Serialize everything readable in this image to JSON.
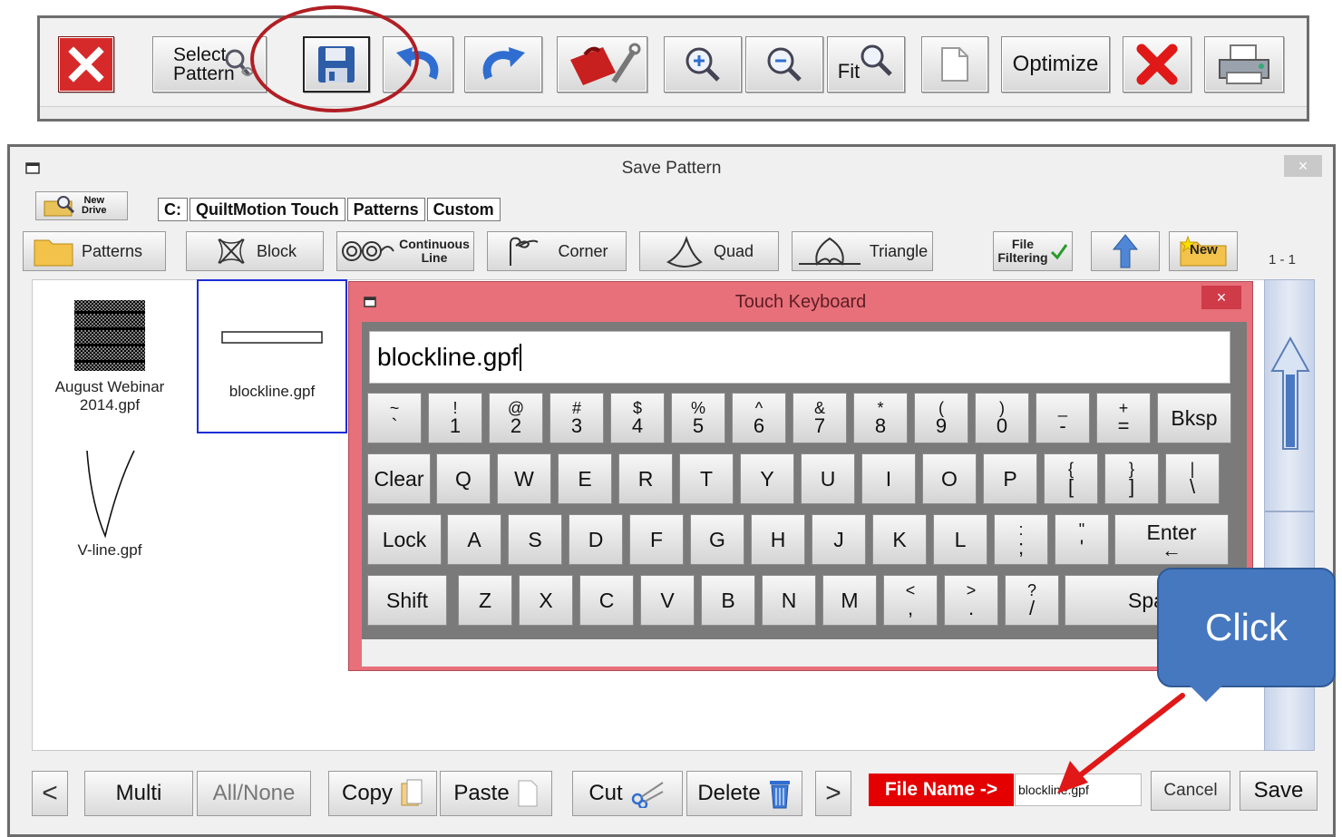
{
  "toolbar": {
    "select_pattern_line1": "Select",
    "select_pattern_line2": "Pattern",
    "fit_label": "Fit",
    "optimize_label": "Optimize"
  },
  "dialog": {
    "title": "Save Pattern",
    "close_glyph": "×",
    "new_drive_line1": "New",
    "new_drive_line2": "Drive",
    "breadcrumbs": [
      "C:",
      "QuiltMotion Touch",
      "Patterns",
      "Custom"
    ],
    "categories": {
      "patterns": "Patterns",
      "block": "Block",
      "continuous_line1": "Continuous",
      "continuous_line2": "Line",
      "corner": "Corner",
      "quad": "Quad",
      "triangle": "Triangle",
      "file_filtering_line1": "File",
      "file_filtering_line2": "Filtering",
      "new": "New"
    },
    "page_count": "1 - 1",
    "files": [
      {
        "name_line1": "August Webinar",
        "name_line2": "2014.gpf"
      },
      {
        "name_line1": "blockline.gpf",
        "name_line2": ""
      },
      {
        "name_line1": "V-line.gpf",
        "name_line2": ""
      }
    ],
    "bottom": {
      "prev": "<",
      "multi": "Multi",
      "all_none": "All/None",
      "copy": "Copy",
      "paste": "Paste",
      "cut": "Cut",
      "delete": "Delete",
      "next": ">",
      "file_name_label": "File Name ->",
      "file_name_value": "blockline.gpf",
      "cancel": "Cancel",
      "save": "Save"
    }
  },
  "keyboard": {
    "title": "Touch Keyboard",
    "close_glyph": "×",
    "input_value": "blockline.gpf",
    "row1": [
      {
        "top": "~",
        "bot": "`"
      },
      {
        "top": "!",
        "bot": "1"
      },
      {
        "top": "@",
        "bot": "2"
      },
      {
        "top": "#",
        "bot": "3"
      },
      {
        "top": "$",
        "bot": "4"
      },
      {
        "top": "%",
        "bot": "5"
      },
      {
        "top": "^",
        "bot": "6"
      },
      {
        "top": "&",
        "bot": "7"
      },
      {
        "top": "*",
        "bot": "8"
      },
      {
        "top": "(",
        "bot": "9"
      },
      {
        "top": ")",
        "bot": "0"
      },
      {
        "top": "_",
        "bot": "-"
      },
      {
        "top": "+",
        "bot": "="
      }
    ],
    "bksp": "Bksp",
    "clear": "Clear",
    "row2": [
      "Q",
      "W",
      "E",
      "R",
      "T",
      "Y",
      "U",
      "I",
      "O",
      "P"
    ],
    "row2_sym": [
      {
        "top": "{",
        "bot": "["
      },
      {
        "top": "}",
        "bot": "]"
      },
      {
        "top": "|",
        "bot": "\\"
      }
    ],
    "lock": "Lock",
    "row3": [
      "A",
      "S",
      "D",
      "F",
      "G",
      "H",
      "J",
      "K",
      "L"
    ],
    "row3_sym": [
      {
        "top": ":",
        "bot": ";"
      },
      {
        "top": "\"",
        "bot": "'"
      }
    ],
    "enter": "Enter",
    "shift": "Shift",
    "row4": [
      "Z",
      "X",
      "C",
      "V",
      "B",
      "N",
      "M"
    ],
    "row4_sym": [
      {
        "top": "<",
        "bot": ","
      },
      {
        "top": ">",
        "bot": "."
      },
      {
        "top": "?",
        "bot": "/"
      }
    ],
    "space": "Spa"
  },
  "callout": {
    "text": "Click"
  },
  "colors": {
    "annotation_red": "#b01f24",
    "keyboard_frame": "#e7707a",
    "file_name_label": "#e40000",
    "callout": "#4678c0"
  }
}
